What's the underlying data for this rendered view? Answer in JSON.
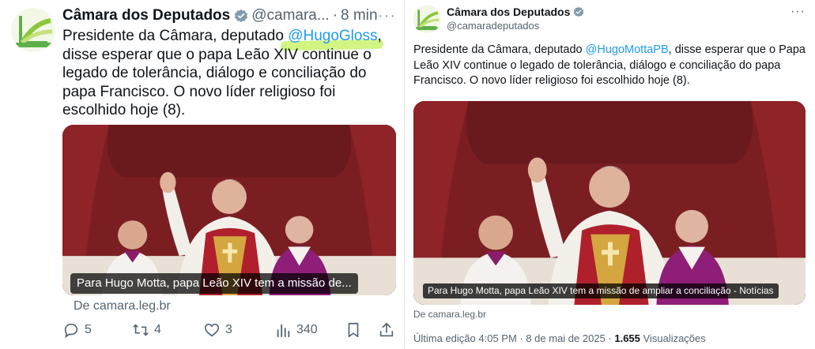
{
  "left_tweet": {
    "account_name": "Câmara dos Deputados",
    "handle": "@camara...",
    "separator": "·",
    "time": "8 min",
    "more": "···",
    "text_before": "Presidente da Câmara, deputado ",
    "mention": "@HugoGloss",
    "text_after": ", disse esperar que o papa Leão XIV continue o legado de tolerância, diálogo e conciliação do papa Francisco. O novo líder religioso foi escolhido hoje (8).",
    "card_title": "Para Hugo Motta, papa Leão XIV tem a missão de...",
    "card_source": "De camara.leg.br",
    "replies": "5",
    "retweets": "4",
    "likes": "3",
    "views": "340",
    "highlight_color": "#c9f26d"
  },
  "right_tweet": {
    "account_name": "Câmara dos Deputados",
    "handle": "@camaradeputados",
    "more": "···",
    "text_before": "Presidente da Câmara, deputado ",
    "mention": "@HugoMottaPB",
    "text_after": ", disse esperar que o Papa Leão XIV continue o legado de tolerância, diálogo e conciliação do papa Francisco. O novo líder religioso foi escolhido hoje (8).",
    "card_title": "Para Hugo Motta, papa Leão XIV tem a missão de ampliar a conciliação - Notícias",
    "card_source": "De camara.leg.br",
    "edited_label": "Última edição 4:05 PM · 8 de mai de 2025 · ",
    "views_count": "1.655",
    "views_label": " Visualizações"
  },
  "colors": {
    "link": "#1d9bf0",
    "secondary_text": "#536471",
    "verified_badge": "#829aab",
    "curtain": "#7a1e22"
  },
  "icons": [
    "verified-badge-icon",
    "more-icon",
    "reply-icon",
    "retweet-icon",
    "like-icon",
    "views-icon",
    "bookmark-icon",
    "share-icon"
  ]
}
